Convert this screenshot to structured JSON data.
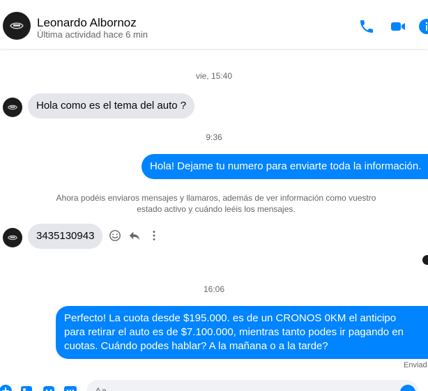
{
  "header": {
    "name": "Leonardo Albornoz",
    "status": "Última actividad hace 6 min"
  },
  "messages": {
    "timestamp_1": "vie, 15:40",
    "in_1": "Hola como es el tema del auto ?",
    "timestamp_2": "9:36",
    "out_1": "Hola! Dejame tu numero  para enviarte toda la información.",
    "notice": "Ahora podéis enviaros mensajes y llamaros, además de ver información como vuestro estado activo y cuándo leéis los mensajes.",
    "in_2": "3435130943",
    "timestamp_3": "16:06",
    "out_2": "Perfecto! La cuota desde $195.000. es de un CRONOS 0KM el anticipo para retirar el auto es de $7.100.000, mientras tanto podes ir pagando en cuotas. Cuándo podes hablar? A la mañana o a la tarde?",
    "sent_status": "Enviad"
  },
  "composer": {
    "placeholder": "Aa"
  },
  "colors": {
    "accent": "#0084ff",
    "incoming_bubble": "#e4e6eb",
    "secondary_text": "#65676b"
  },
  "icons": [
    "phone-icon",
    "video-camera-icon",
    "info-icon",
    "emoji-icon",
    "reply-icon",
    "more-options-icon",
    "plus-icon",
    "image-icon",
    "sticker-icon",
    "gif-icon"
  ]
}
